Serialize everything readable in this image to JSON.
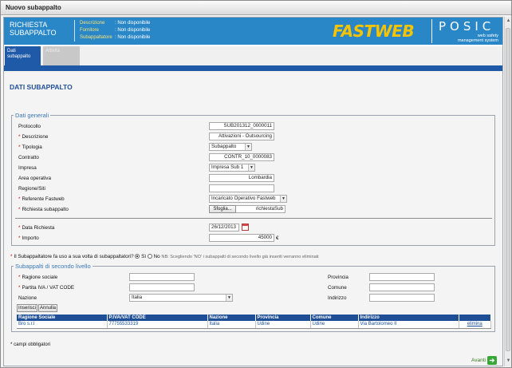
{
  "window": {
    "title": "Nuovo subappalto"
  },
  "header": {
    "title": "RICHIESTA SUBAPPALTO",
    "info": [
      {
        "label": "Descrizione",
        "value": ": Non disponibile"
      },
      {
        "label": "Fornitore",
        "value": ": Non disponibile"
      },
      {
        "label": "Subappaltatore",
        "value": ": Non disponibile"
      }
    ],
    "logo_text": "FASTWEB",
    "posic": "POSIC",
    "posic_sub1": "web safety",
    "posic_sub2": "management system",
    "brand_color": "#2a87c7",
    "logo_color": "#f5c400"
  },
  "tabs": [
    {
      "label": "Dati subappalto",
      "active": true
    },
    {
      "label": "Attività",
      "active": false
    }
  ],
  "page_title": "DATI SUBAPPALTO",
  "general": {
    "legend": "Dati generali",
    "protocollo": {
      "label": "Protocollo",
      "value": "SUB201312_0000011"
    },
    "descrizione": {
      "label": "Descrizione",
      "value": "Attivazioni - Outsourcing"
    },
    "tipologia": {
      "label": "Tipologia",
      "value": "Subappalto"
    },
    "contratto": {
      "label": "Contratto",
      "value": "CONTR_10_0000083"
    },
    "impresa": {
      "label": "Impresa",
      "value": "Impresa Sub 1"
    },
    "area": {
      "label": "Area operativa",
      "value": "Lombardia"
    },
    "regione": {
      "label": "Regione/Siti",
      "value": ""
    },
    "referente": {
      "label": "Referente Fastweb",
      "value": "Incaricato Operativo Fastweb"
    },
    "richiesta": {
      "label": "Richiesta subappalto",
      "button": "Sfoglia...",
      "file": "richiestaSub"
    },
    "data": {
      "label": "Data Richiesta",
      "value": "26/12/2013"
    },
    "importo": {
      "label": "Importo",
      "value": "45000",
      "currency": "€"
    },
    "required_mark": "*"
  },
  "question": {
    "text": "Il Subappaltatore fa uso a sua volta di subappaltatori?",
    "si": "Sì",
    "no": "No",
    "note": "NB: Scegliendo 'NO' i subappalti di secondo livello già inseriti verranno eliminati"
  },
  "second": {
    "legend": "Subappalti di secondo livello",
    "ragione": {
      "label": "Ragione sociale",
      "value": ""
    },
    "piva": {
      "label": "Partita IVA / VAT CODE",
      "value": ""
    },
    "nazione": {
      "label": "Nazione",
      "value": "Italia"
    },
    "provincia": {
      "label": "Provincia",
      "value": ""
    },
    "comune": {
      "label": "Comune",
      "value": ""
    },
    "indirizzo": {
      "label": "Indirizzo",
      "value": ""
    },
    "btn_insert": "Inserisci",
    "btn_cancel": "Annulla",
    "columns": [
      "Ragione Sociale",
      "P.IVA/VAT CODE",
      "Nazione",
      "Provincia",
      "Comune",
      "Indirizzo",
      ""
    ],
    "rows": [
      {
        "ragione": "Bro s.r.l",
        "piva": "77755533319",
        "nazione": "Italia",
        "provincia": "Udine",
        "comune": "Udine",
        "indirizzo": "Via Bartolomeo II",
        "action": "elimina"
      }
    ]
  },
  "footnote": "* campi obbligatori",
  "next": {
    "label": "Avanti",
    "icon": "arrow-right-icon"
  }
}
